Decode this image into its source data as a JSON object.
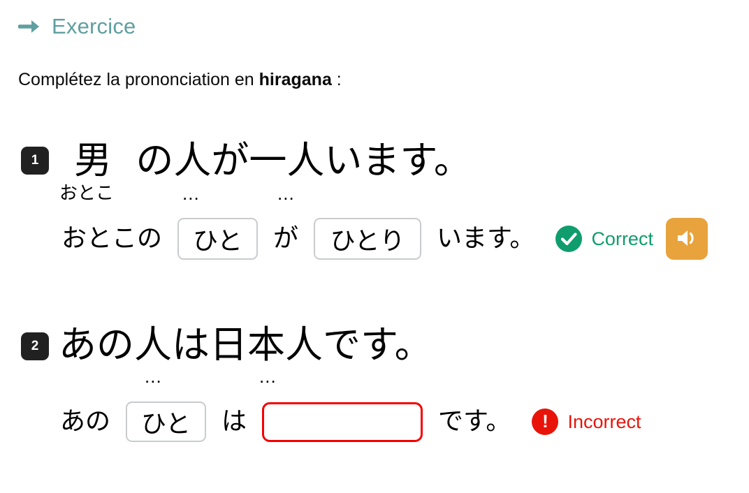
{
  "header": {
    "arrow_icon": "arrow-right-icon",
    "title": "Exercice",
    "accent_color": "#5f9fa0"
  },
  "instruction": {
    "before": "Complétez la prononciation en ",
    "emphasis": "hiragana",
    "after": " :"
  },
  "items": [
    {
      "number": "1",
      "sentence": "男  の人が一人います。",
      "furigana": "おとこ",
      "dots_1": "...",
      "dots_2": "...",
      "answer": {
        "prefix": "おとこの",
        "input_1": "ひと",
        "middle": "が",
        "input_2": "ひとり",
        "suffix": "います。"
      },
      "status": {
        "icon": "check-circle-icon",
        "label": "Correct",
        "color": "#0f9d6e",
        "state": "correct"
      },
      "audio": {
        "icon": "speaker-icon",
        "color": "#e8a33d"
      }
    },
    {
      "number": "2",
      "sentence": "あの人は日本人です。",
      "dots_1": "...",
      "dots_2": "...",
      "answer": {
        "prefix": "あの",
        "input_1": "ひと",
        "middle": "は",
        "input_2": "",
        "suffix": "です。"
      },
      "status": {
        "icon": "exclamation-circle-icon",
        "label": "Incorrect",
        "color": "#e8140a",
        "state": "incorrect"
      }
    }
  ]
}
